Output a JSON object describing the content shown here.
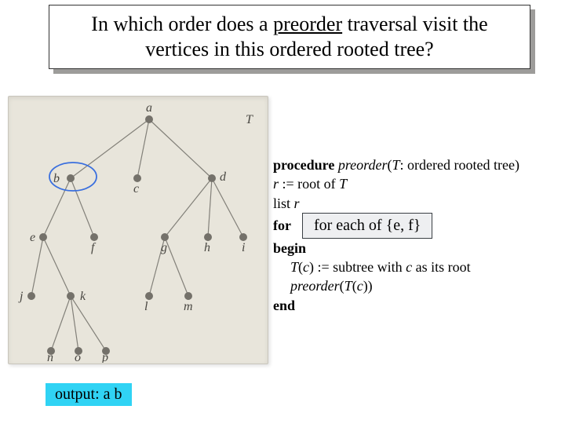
{
  "title": {
    "pre": "In which order does a ",
    "underlined": "preorder",
    "post": " traversal visit the vertices in this ordered rooted tree?"
  },
  "tree": {
    "label_T": "T",
    "nodes": {
      "a": "a",
      "b": "b",
      "c": "c",
      "d": "d",
      "e": "e",
      "f": "f",
      "g": "g",
      "h": "h",
      "i": "i",
      "j": "j",
      "k": "k",
      "l": "l",
      "m": "m",
      "n": "n",
      "o": "o",
      "p": "p"
    }
  },
  "pseudo": {
    "l1_kw": "procedure",
    "l1_name": "preorder",
    "l1_rest1": "(",
    "l1_rest2": "T",
    "l1_rest3": ": ordered rooted tree)",
    "l2_a": "r",
    "l2_b": " := root of ",
    "l2_c": "T",
    "l3_a": "list ",
    "l3_b": "r",
    "l4_kw": "for",
    "l4_overlay": "for each of {e, f}",
    "l5_kw": "begin",
    "l6_a": "T",
    "l6_b": "(",
    "l6_c": "c",
    "l6_d": ") := subtree with ",
    "l6_e": "c",
    "l6_f": " as its root",
    "l7_a": "preorder",
    "l7_b": "(",
    "l7_c": "T",
    "l7_d": "(",
    "l7_e": "c",
    "l7_f": "))",
    "l8_kw": "end"
  },
  "output": {
    "text": "output: a b"
  }
}
